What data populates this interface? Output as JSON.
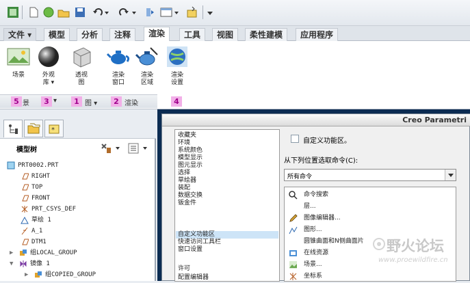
{
  "quick_access": {
    "icons": [
      "app-icon",
      "new-icon",
      "circle-icon",
      "open-icon",
      "save-icon",
      "undo-icon",
      "redo-icon",
      "regenerate-icon",
      "window-icon",
      "close-icon",
      "customize-icon"
    ]
  },
  "tabs": [
    {
      "label": "文件 ▾"
    },
    {
      "label": "模型"
    },
    {
      "label": "分析"
    },
    {
      "label": "注释"
    },
    {
      "label": "渲染"
    },
    {
      "label": "工具"
    },
    {
      "label": "视图"
    },
    {
      "label": "柔性建模"
    },
    {
      "label": "应用程序"
    }
  ],
  "ribbon": {
    "buttons": [
      {
        "label_line1": "场景",
        "label_line2": ""
      },
      {
        "label_line1": "外观",
        "label_line2": "库 ▾"
      },
      {
        "label_line1": "透视",
        "label_line2": "图"
      },
      {
        "label_line1": "渲染",
        "label_line2": "窗口"
      },
      {
        "label_line1": "渲染",
        "label_line2": "区域"
      },
      {
        "label_line1": "渲染",
        "label_line2": "设置"
      }
    ],
    "group_bar": {
      "badges": [
        "5",
        "3",
        "1",
        "2",
        "4"
      ],
      "texts": [
        "景",
        "▾",
        "图 ▾",
        "渲染"
      ]
    }
  },
  "model_tree": {
    "header": "模型树",
    "items": [
      {
        "label": "PRT0002.PRT"
      },
      {
        "label": "RIGHT"
      },
      {
        "label": "TOP"
      },
      {
        "label": "FRONT"
      },
      {
        "label": "PRT_CSYS_DEF"
      },
      {
        "label": "草绘 1"
      },
      {
        "label": "A_1"
      },
      {
        "label": "DTM1"
      },
      {
        "label": "组LOCAL_GROUP"
      },
      {
        "label": "镜像 1"
      },
      {
        "label": "组COPIED_GROUP"
      }
    ]
  },
  "dialog": {
    "title": "Creo Parametri",
    "categories": [
      "收藏夹",
      "环境",
      "系统颜色",
      "模型显示",
      "图元显示",
      "选择",
      "草绘器",
      "装配",
      "数据交换",
      "钣金件",
      "自定义功能区",
      "快速访问工具栏",
      "窗口设置",
      "许可",
      "配置编辑器"
    ],
    "selected_category": "自定义功能区",
    "heading": "自定义功能区。",
    "choose_label": "从下列位置选取命令(C):",
    "combo_value": "所有命令",
    "commands": [
      "命令搜索",
      "层...",
      "图像编辑器...",
      "图形...",
      "圆锥曲面和N侧曲面片",
      "在线资源",
      "场景...",
      "坐标系"
    ]
  },
  "watermark": {
    "text": "野火论坛",
    "url": "www.proewildfire.cn"
  },
  "colors": {
    "dark_bar": "#0c2c52",
    "badge_bg": "#f2b0e8",
    "badge_fg": "#a0008c",
    "selection": "#cde4f7"
  }
}
